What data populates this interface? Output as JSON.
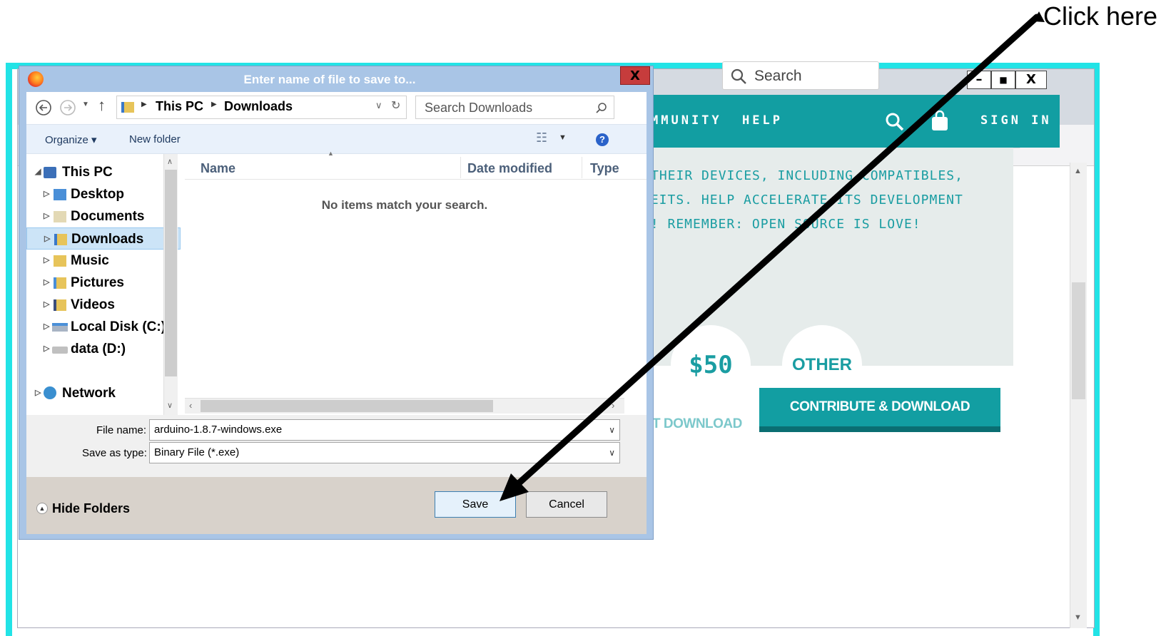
{
  "annotation": {
    "text": "Click here"
  },
  "browser": {
    "window_controls": {
      "minimize": "–",
      "maximize": "■",
      "close": "X"
    },
    "search_placeholder": "Search",
    "nav_items": [
      "MMUNITY",
      "HELP"
    ],
    "signin_label": "SIGN IN",
    "body_lines": [
      "THEIR DEVICES, INCLUDING COMPATIBLES,",
      "FEITS. HELP ACCELERATE ITS DEVELOPMENT",
      "N! REMEMBER: OPEN SOURCE IS LOVE!"
    ],
    "amount_50": "$50",
    "amount_other": "OTHER",
    "just_download": "T DOWNLOAD",
    "contribute_download": "CONTRIBUTE & DOWNLOAD",
    "colors": {
      "teal": "#129ea2",
      "frame": "#22e3e6"
    }
  },
  "dialog": {
    "title": "Enter name of file to save to...",
    "close_label": "X",
    "breadcrumb": [
      "This PC",
      "Downloads"
    ],
    "search_placeholder": "Search Downloads",
    "organize_label": "Organize",
    "new_folder_label": "New folder",
    "nav_pane": [
      {
        "label": "This PC",
        "level": 0,
        "icon": "pc-icon"
      },
      {
        "label": "Desktop",
        "level": 1,
        "icon": "desktop-folder-icon"
      },
      {
        "label": "Documents",
        "level": 1,
        "icon": "documents-folder-icon"
      },
      {
        "label": "Downloads",
        "level": 1,
        "icon": "downloads-folder-icon",
        "selected": true
      },
      {
        "label": "Music",
        "level": 1,
        "icon": "music-folder-icon"
      },
      {
        "label": "Pictures",
        "level": 1,
        "icon": "pictures-folder-icon"
      },
      {
        "label": "Videos",
        "level": 1,
        "icon": "videos-folder-icon"
      },
      {
        "label": "Local Disk (C:)",
        "level": 1,
        "icon": "local-disk-icon"
      },
      {
        "label": "data (D:)",
        "level": 1,
        "icon": "drive-icon"
      },
      {
        "label": "Network",
        "level": 0,
        "icon": "network-icon"
      }
    ],
    "columns": [
      "Name",
      "Date modified",
      "Type"
    ],
    "empty_message": "No items match your search.",
    "file_name_label": "File name:",
    "file_name_value": "arduino-1.8.7-windows.exe",
    "save_type_label": "Save as type:",
    "save_type_value": "Binary File (*.exe)",
    "hide_folders_label": "Hide Folders",
    "save_label": "Save",
    "cancel_label": "Cancel"
  }
}
